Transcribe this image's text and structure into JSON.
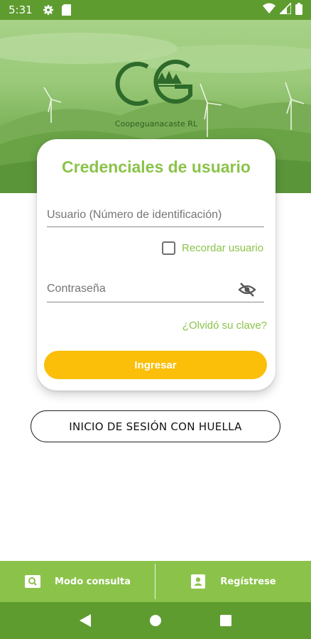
{
  "status_bar": {
    "time": "5:31",
    "icons": [
      "settings-icon",
      "sd-card-icon",
      "wifi-icon",
      "signal-icon",
      "battery-icon"
    ]
  },
  "brand": {
    "logo_letters": "CG",
    "name": "Coopeguanacaste RL"
  },
  "login_card": {
    "title": "Credenciales de usuario",
    "username_placeholder": "Usuario (Número de identificación)",
    "username_value": "",
    "remember_label": "Recordar usuario",
    "remember_checked": false,
    "password_placeholder": "Contraseña",
    "password_value": "",
    "forgot_label": "¿Olvidó su clave?",
    "login_label": "Ingresar"
  },
  "fingerprint_button": {
    "label": "INICIO DE SESIÓN CON HUELLA"
  },
  "bottom_tabs": [
    {
      "label": "Modo consulta",
      "icon": "search-document-icon"
    },
    {
      "label": "Regístrese",
      "icon": "contact-card-icon"
    }
  ],
  "colors": {
    "accent_green": "#8bc34a",
    "dark_green": "#5e9c2f",
    "button_yellow": "#fbbf0a"
  }
}
